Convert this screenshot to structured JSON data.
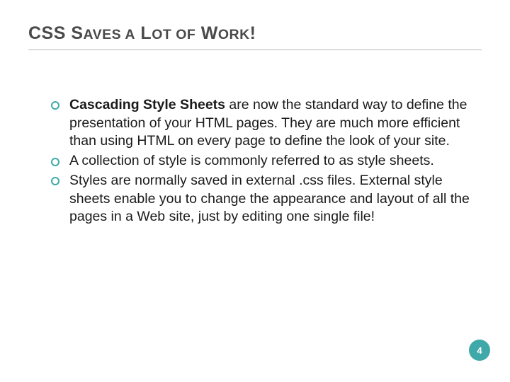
{
  "slide": {
    "title_parts": {
      "p0": "CSS",
      "p1": " S",
      "p2": "AVES",
      "p3": " A",
      "p4": " L",
      "p5": "OT",
      "p6": " OF",
      "p7": " W",
      "p8": "ORK",
      "p9": "!"
    },
    "bullets": [
      {
        "lead": "Cascading Style Sheets",
        "rest": " are now the standard way to define the presentation of your HTML pages. They are much more efficient than using HTML on every page to define the look of your site."
      },
      {
        "lead": "",
        "rest": "A collection of style is commonly referred to as style sheets."
      },
      {
        "lead": "",
        "rest": "Styles are normally saved in external .css files. External style sheets enable you to change the appearance and layout of all the pages in a Web site, just by editing one single file!"
      }
    ],
    "page_number": "4"
  }
}
